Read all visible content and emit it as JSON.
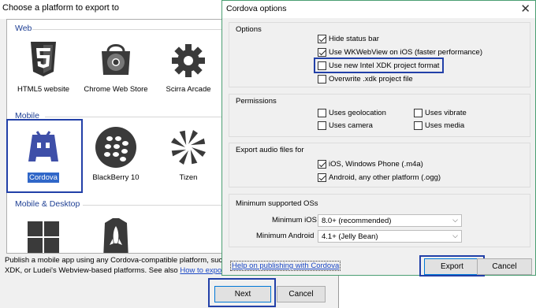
{
  "background_window": {
    "title": "Choose a platform to export to",
    "categories": [
      {
        "label": "Web",
        "platforms": [
          {
            "label": "HTML5 website",
            "icon": "html5-icon"
          },
          {
            "label": "Chrome Web Store",
            "icon": "chrome-web-store-icon"
          },
          {
            "label": "Scirra Arcade",
            "icon": "gear-icon"
          }
        ]
      },
      {
        "label": "Mobile",
        "platforms": [
          {
            "label": "Cordova",
            "icon": "cordova-icon",
            "selected": true
          },
          {
            "label": "BlackBerry 10",
            "icon": "blackberry-icon"
          },
          {
            "label": "Tizen",
            "icon": "tizen-icon"
          }
        ]
      },
      {
        "label": "Mobile & Desktop",
        "platforms": [
          {
            "label": "",
            "icon": "windows-icon"
          },
          {
            "label": "",
            "icon": "rocket-icon"
          }
        ]
      }
    ],
    "description_line1": "Publish a mobile app using any Cordova-compatible platform, such a",
    "description_line2": "XDK, or Ludei's Webview-based platforms. See also ",
    "description_link": "How to export t",
    "next_label": "Next",
    "cancel_label": "Cancel"
  },
  "dialog": {
    "title": "Cordova options",
    "close_glyph": "✕",
    "options": {
      "title": "Options",
      "items": [
        {
          "label": "Hide status bar",
          "checked": true
        },
        {
          "label": "Use WKWebView on iOS (faster performance)",
          "checked": true
        },
        {
          "label": "Use new Intel XDK project format",
          "checked": false,
          "highlighted": true
        },
        {
          "label": "Overwrite .xdk project file",
          "checked": false
        }
      ]
    },
    "permissions": {
      "title": "Permissions",
      "items": [
        {
          "label": "Uses geolocation",
          "checked": false
        },
        {
          "label": "Uses vibrate",
          "checked": false
        },
        {
          "label": "Uses camera",
          "checked": false
        },
        {
          "label": "Uses media",
          "checked": false
        }
      ]
    },
    "audio": {
      "title": "Export audio files for",
      "items": [
        {
          "label": "iOS, Windows Phone (.m4a)",
          "checked": true
        },
        {
          "label": "Android, any other platform (.ogg)",
          "checked": true
        }
      ]
    },
    "min_os": {
      "title": "Minimum supported OSs",
      "ios_label": "Minimum iOS",
      "ios_value": "8.0+ (recommended)",
      "android_label": "Minimum Android",
      "android_value": "4.1+ (Jelly Bean)"
    },
    "help_link": "Help on publishing with Cordova",
    "export_label": "Export",
    "cancel_label": "Cancel"
  },
  "colors": {
    "accent": "#2240a8",
    "selection": "#3067c8",
    "link": "#1c49c6",
    "dialog_border": "#4a9e72"
  }
}
